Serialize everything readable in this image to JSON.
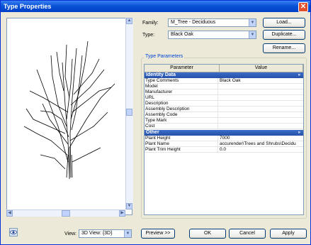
{
  "window": {
    "title": "Type Properties",
    "close": "✕"
  },
  "family": {
    "label": "Family:",
    "value": "M_Tree - Deciduous"
  },
  "type": {
    "label": "Type:",
    "value": "Black Oak"
  },
  "buttons": {
    "load": "Load...",
    "duplicate": "Duplicate...",
    "rename": "Rename...",
    "preview": "Preview >>",
    "ok": "OK",
    "cancel": "Cancel",
    "apply": "Apply"
  },
  "type_parameters": {
    "group_title": "Type Parameters",
    "headers": {
      "parameter": "Parameter",
      "value": "Value"
    },
    "identity": {
      "title": "Identity Data",
      "rows": [
        {
          "p": "Type Comments",
          "v": "Black Oak"
        },
        {
          "p": "Model",
          "v": ""
        },
        {
          "p": "Manufacturer",
          "v": ""
        },
        {
          "p": "URL",
          "v": ""
        },
        {
          "p": "Description",
          "v": ""
        },
        {
          "p": "Assembly Description",
          "v": ""
        },
        {
          "p": "Assembly Code",
          "v": ""
        },
        {
          "p": "Type Mark",
          "v": ""
        },
        {
          "p": "Cost",
          "v": ""
        }
      ]
    },
    "other": {
      "title": "Other",
      "rows": [
        {
          "p": "Plant Height",
          "v": "7000"
        },
        {
          "p": "Plant Name",
          "v": "accurender\\Trees and Shrubs\\Decidu"
        },
        {
          "p": "Plant Trim Height",
          "v": "0.0"
        }
      ]
    },
    "collapse_glyph": "»"
  },
  "view": {
    "label": "View:",
    "value": "3D View: {3D}"
  },
  "icons": {
    "close": "close-icon",
    "dropdown": "chevron-down-icon",
    "eye": "eye-icon"
  }
}
